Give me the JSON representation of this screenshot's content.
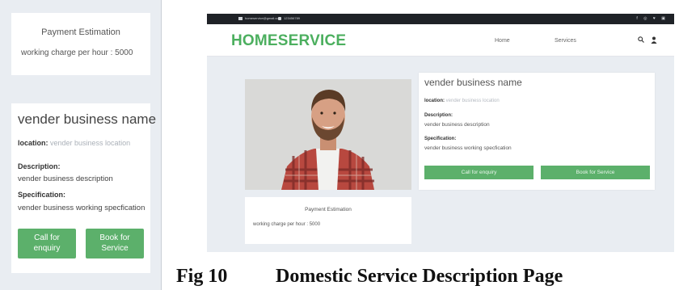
{
  "mobile": {
    "payment": {
      "title": "Payment Estimation",
      "rate": "working charge per hour : 5000"
    },
    "vendor": {
      "name": "vender business name",
      "location_label": "location:",
      "location_value": "vender business location",
      "description_label": "Description:",
      "description": "vender business description",
      "specification_label": "Specification:",
      "specification": "vender business working specfication",
      "call_button": "Call for enquiry",
      "book_button": "Book for Service"
    }
  },
  "desktop": {
    "topbar": {
      "email": "homeservice@gmail.com",
      "phone": "123456789"
    },
    "brand": "HOMESERVICE",
    "nav": {
      "home": "Home",
      "services": "Services"
    },
    "vendor": {
      "name": "vender business name",
      "location_label": "location:",
      "location_value": "vender business location",
      "description_label": "Description:",
      "description": "vender business description",
      "specification_label": "Specification:",
      "specification": "vender business working specfication",
      "call_button": "Call for enquiry",
      "book_button": "Book for Service"
    },
    "payment": {
      "title": "Payment Estimation",
      "rate": "working charge per hour : 5000"
    }
  },
  "caption": {
    "number": "Fig 10",
    "title": "Domestic Service Description Page"
  },
  "colors": {
    "accent": "#5cb06b",
    "brand": "#4caf5f",
    "background": "#e9edf2",
    "topbar": "#1f2227"
  }
}
